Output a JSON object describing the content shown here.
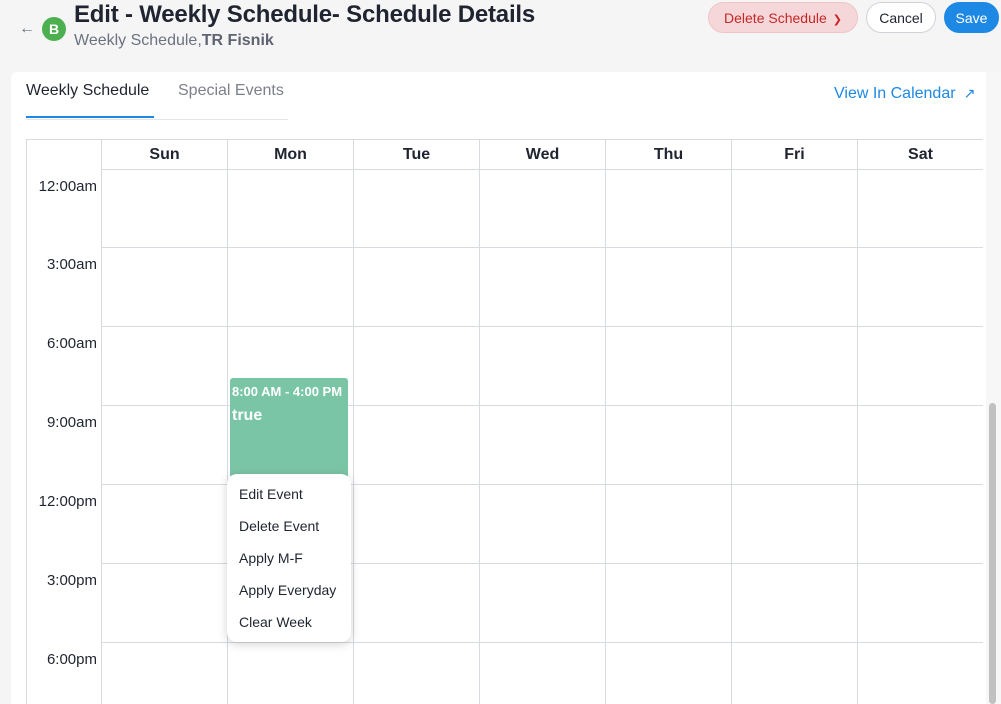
{
  "header": {
    "title": "Edit - Weekly Schedule- Schedule Details",
    "avatar_letter": "B",
    "subtitle_prefix": "Weekly Schedule,",
    "subtitle_bold": "TR Fisnik",
    "back_icon": "arrow-left-icon",
    "buttons": {
      "delete": "Delete Schedule",
      "cancel": "Cancel",
      "save": "Save"
    }
  },
  "tabs": [
    {
      "label": "Weekly Schedule",
      "active": true
    },
    {
      "label": "Special Events",
      "active": false
    }
  ],
  "view_in_calendar": "View In Calendar",
  "calendar": {
    "days": [
      "Sun",
      "Mon",
      "Tue",
      "Wed",
      "Thu",
      "Fri",
      "Sat"
    ],
    "times": [
      "12:00am",
      "3:00am",
      "6:00am",
      "9:00am",
      "12:00pm",
      "3:00pm",
      "6:00pm"
    ],
    "event": {
      "time": "8:00 AM - 4:00 PM",
      "title": "true",
      "day": "Mon"
    }
  },
  "context_menu": [
    "Edit Event",
    "Delete Event",
    "Apply M-F",
    "Apply Everyday",
    "Clear Week"
  ],
  "colors": {
    "primary": "#1e88e5",
    "danger_text": "#c62828",
    "danger_bg": "#f6d7d9",
    "event": "#7bc5a7",
    "avatar": "#4caf50"
  }
}
